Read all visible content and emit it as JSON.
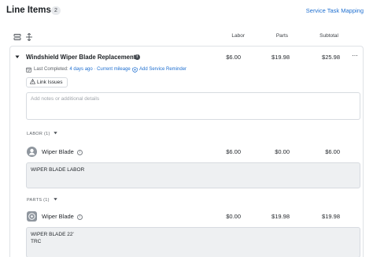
{
  "header": {
    "title": "Line Items",
    "count": "2",
    "link": "Service Task Mapping"
  },
  "columns": {
    "labor": "Labor",
    "parts": "Parts",
    "subtotal": "Subtotal"
  },
  "line_item": {
    "name": "Windshield Wiper Blade Replacement",
    "labor": "$6.00",
    "parts": "$19.98",
    "subtotal": "$25.98",
    "last_completed_label": "Last Completed:",
    "last_completed_value": "4 days ago",
    "last_completed_sep": "·",
    "mileage_link": "Current mileage",
    "add_reminder": "Add Service Reminder",
    "link_issues": "Link Issues",
    "notes_placeholder": "Add notes or additional details"
  },
  "labor_section": {
    "label": "LABOR (1)",
    "item_name": "Wiper Blade",
    "labor": "$6.00",
    "parts": "$0.00",
    "subtotal": "$6.00",
    "description": "WIPER BLADE LABOR"
  },
  "parts_section": {
    "label": "PARTS (1)",
    "item_name": "Wiper Blade",
    "labor": "$0.00",
    "parts": "$19.98",
    "subtotal": "$19.98",
    "description": "WIPER BLADE 22'\nTRC"
  }
}
